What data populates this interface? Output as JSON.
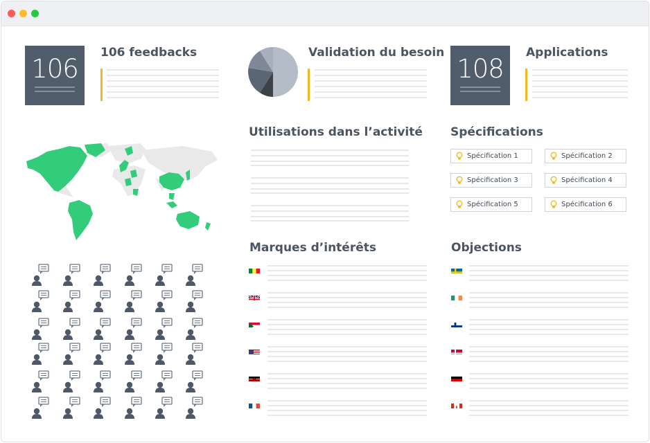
{
  "window": {
    "controls": [
      "close",
      "minimize",
      "maximize"
    ],
    "colors": {
      "close": "#fc5b57",
      "minimize": "#fdbc2e",
      "maximize": "#28c840"
    }
  },
  "feedbacks": {
    "count": "106",
    "title": "106 feedbacks"
  },
  "validation": {
    "title": "Validation du besoin"
  },
  "applications": {
    "count": "108",
    "title": "Applications"
  },
  "usage": {
    "title": "Utilisations dans l’activité"
  },
  "specifications": {
    "title": "Spécifications",
    "items": [
      "Spécification 1",
      "Spécification 2",
      "Spécification 3",
      "Spécification 4",
      "Spécification 5",
      "Spécification 6"
    ]
  },
  "interests": {
    "title": "Marques d’intérêts",
    "flags": [
      "senegal-flag",
      "uk-flag",
      "sudan-flag",
      "usa-flag",
      "kenya-flag",
      "france-flag"
    ]
  },
  "objections": {
    "title": "Objections",
    "flags": [
      "sweden-flag",
      "ireland-flag",
      "finland-flag",
      "denmark-flag",
      "germany-flag",
      "canada-flag"
    ]
  },
  "colors": {
    "accent": "#f2b820",
    "kpi_box": "#515d6b",
    "map_highlight": "#33cc7a",
    "map_base": "#e9e9e9"
  }
}
